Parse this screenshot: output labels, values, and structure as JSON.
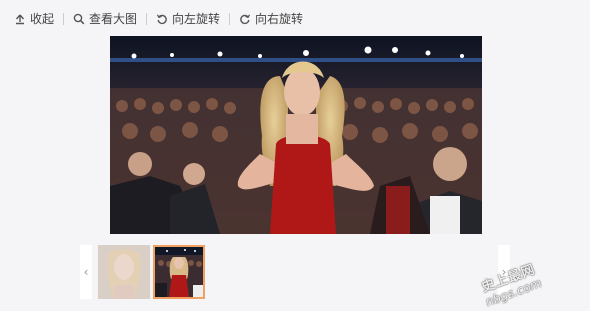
{
  "toolbar": {
    "collapse_label": "收起",
    "view_large_label": "查看大图",
    "rotate_left_label": "向左旋转",
    "rotate_right_label": "向右旋转",
    "icons": {
      "collapse": "collapse-icon",
      "view_large": "search-icon",
      "rotate_left": "rotate-left-icon",
      "rotate_right": "rotate-right-icon"
    }
  },
  "gallery": {
    "thumbnails": [
      {
        "name": "thumbnail-1",
        "selected": false
      },
      {
        "name": "thumbnail-2",
        "selected": true
      }
    ],
    "nav": {
      "prev_label": "‹",
      "next_label": "›"
    }
  },
  "watermark": {
    "line1": "史上最网",
    "line2": "nbgs.com"
  },
  "colors": {
    "background": "#f5f5f7",
    "selected_border": "#f0a060",
    "dress": "#b01818"
  }
}
